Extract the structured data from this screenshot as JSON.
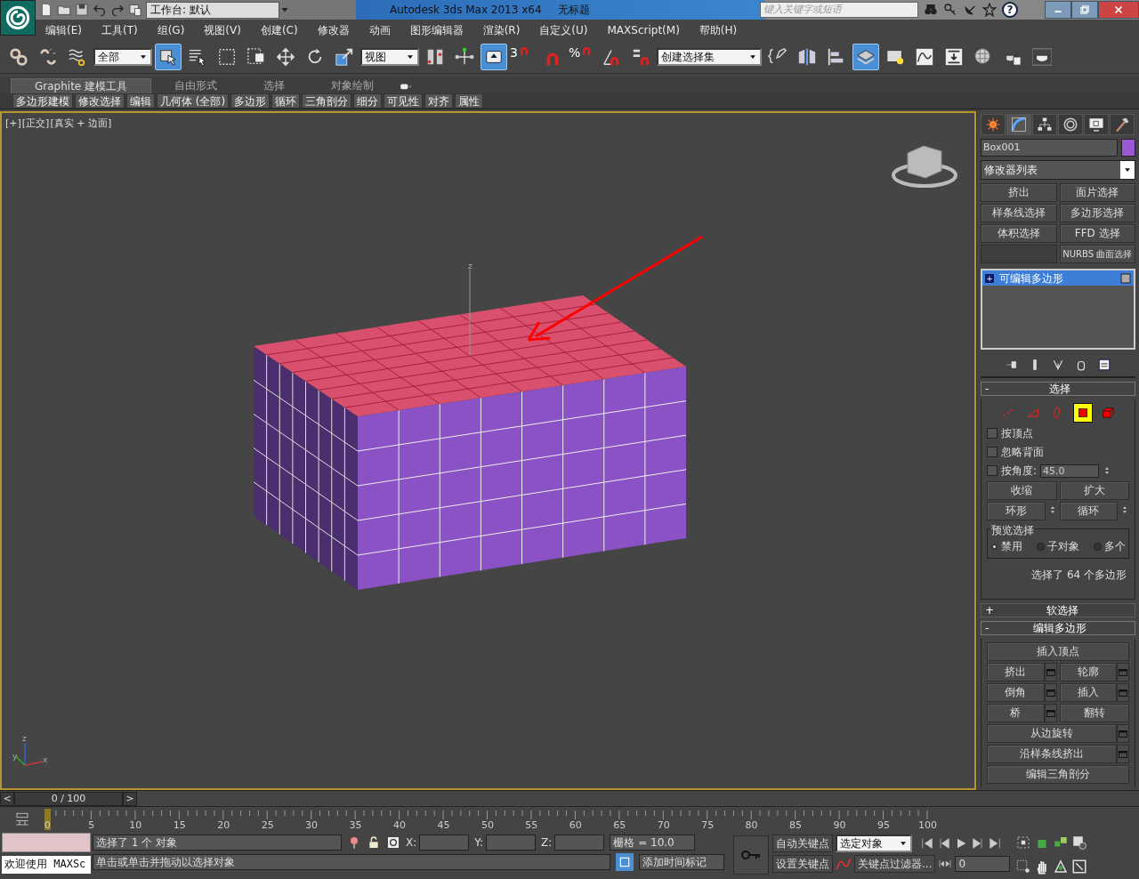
{
  "title_bar": {
    "workspace": "工作台: 默认",
    "title": "Autodesk 3ds Max  2013 x64",
    "document": "无标题",
    "search_placeholder": "键入关键字或短语",
    "help": "?"
  },
  "menu": [
    "编辑(E)",
    "工具(T)",
    "组(G)",
    "视图(V)",
    "创建(C)",
    "修改器",
    "动画",
    "图形编辑器",
    "渲染(R)",
    "自定义(U)",
    "MAXScript(M)",
    "帮助(H)"
  ],
  "toolbar": [
    {
      "kind": "tool",
      "selected": false
    },
    {
      "kind": "tool",
      "selected": false
    },
    {
      "kind": "tool",
      "selected": false
    },
    {
      "kind": "dropdown",
      "value": "全部"
    },
    {
      "kind": "tool",
      "selected": true
    },
    {
      "kind": "tool",
      "selected": false
    },
    {
      "kind": "tool",
      "selected": false
    },
    {
      "kind": "tool",
      "selected": false
    },
    {
      "kind": "tool",
      "selected": false
    },
    {
      "kind": "tool",
      "selected": false
    },
    {
      "kind": "tool",
      "selected": false
    },
    {
      "kind": "dropdown",
      "value": "视图"
    },
    {
      "kind": "tool",
      "selected": false
    },
    {
      "kind": "tool",
      "selected": false
    },
    {
      "kind": "tool",
      "selected": true
    },
    {
      "kind": "snap",
      "label": "3"
    },
    {
      "kind": "tool",
      "selected": false
    },
    {
      "kind": "snap",
      "label": "%"
    },
    {
      "kind": "tool",
      "selected": false
    },
    {
      "kind": "tool",
      "selected": false
    },
    {
      "kind": "dropdown",
      "value": "创建选择集"
    },
    {
      "kind": "tool",
      "selected": false
    },
    {
      "kind": "tool",
      "selected": false
    },
    {
      "kind": "tool",
      "selected": false
    },
    {
      "kind": "tool",
      "selected": true
    },
    {
      "kind": "tool",
      "selected": false
    },
    {
      "kind": "tool",
      "selected": false
    },
    {
      "kind": "tool",
      "selected": false
    },
    {
      "kind": "tool",
      "selected": false
    },
    {
      "kind": "tool",
      "selected": false
    },
    {
      "kind": "tool",
      "selected": false
    }
  ],
  "ribbon": {
    "tabs": [
      {
        "label": "Graphite 建模工具",
        "selected": true
      },
      {
        "label": "自由形式",
        "selected": false
      },
      {
        "label": "选择",
        "selected": false
      },
      {
        "label": "对象绘制",
        "selected": false
      }
    ],
    "panels": [
      "多边形建模",
      "修改选择",
      "编辑",
      "几何体 (全部)",
      "多边形",
      "循环",
      "三角剖分",
      "细分",
      "可见性",
      "对齐",
      "属性"
    ]
  },
  "viewport": {
    "labels": [
      "[+]",
      "[正交]",
      "[真实 + 边面]"
    ],
    "gizmo_axis": "z",
    "tripod": [
      "z",
      "y",
      "x"
    ]
  },
  "command_panel": {
    "tabs": [
      {
        "selected": false
      },
      {
        "selected": true
      },
      {
        "selected": false
      },
      {
        "selected": false
      },
      {
        "selected": false
      },
      {
        "selected": false
      }
    ],
    "object": {
      "name": "Box001",
      "color": "#9b59d6"
    },
    "modifier_list": "修改器列表",
    "modifier_buttons": [
      {
        "label": "挤出"
      },
      {
        "label": "面片选择"
      },
      {
        "label": "样条线选择"
      },
      {
        "label": "多边形选择"
      },
      {
        "label": "体积选择"
      },
      {
        "label": "FFD 选择"
      },
      {
        "kind": "blank"
      },
      {
        "label": "NURBS 曲面选择"
      }
    ],
    "stack": [
      {
        "label": "可编辑多边形",
        "selected": true,
        "expand": "+"
      }
    ],
    "selection_rollout": {
      "title": "选择",
      "toggle": "-",
      "expanded": true,
      "subobjects": [
        {
          "selected": false
        },
        {
          "selected": false
        },
        {
          "selected": false
        },
        {
          "selected": true
        },
        {
          "selected": false
        }
      ],
      "checkboxes": [
        {
          "label": "按顶点",
          "checked": false
        },
        {
          "label": "忽略背面",
          "checked": false
        },
        {
          "label": "按角度:",
          "checked": false
        }
      ],
      "angle": "45.0",
      "buttons": [
        "收缩",
        "扩大",
        "环形",
        "循环"
      ],
      "preview": {
        "title": "预览选择",
        "options": [
          {
            "label": "禁用",
            "selected": true
          },
          {
            "label": "子对象",
            "selected": false
          },
          {
            "label": "多个",
            "selected": false
          }
        ]
      },
      "status": "选择了 64 个多边形"
    },
    "soft_selection": {
      "title": "软选择",
      "toggle": "+",
      "expanded": false
    },
    "edit_poly": {
      "title": "编辑多边形",
      "toggle": "-",
      "expanded": true,
      "buttons": [
        {
          "label": "插入顶点",
          "wide": true,
          "settings": false
        },
        {
          "label": "挤出",
          "wide": false,
          "settings": true
        },
        {
          "label": "轮廓",
          "wide": false,
          "settings": true
        },
        {
          "label": "倒角",
          "wide": false,
          "settings": true
        },
        {
          "label": "插入",
          "wide": false,
          "settings": true
        },
        {
          "label": "桥",
          "wide": false,
          "settings": true
        },
        {
          "label": "翻转",
          "wide": false,
          "settings": false
        },
        {
          "label": "从边旋转",
          "wide": true,
          "settings": true
        },
        {
          "label": "沿样条线挤出",
          "wide": true,
          "settings": true
        },
        {
          "label": "编辑三角剖分",
          "wide": true,
          "settings": false
        }
      ]
    }
  },
  "time_slider": {
    "label": "0 / 100",
    "prev": "<",
    "next": ">",
    "frames": [
      "0",
      "5",
      "10",
      "15",
      "20",
      "25",
      "30",
      "35",
      "40",
      "45",
      "50",
      "55",
      "60",
      "65",
      "70",
      "75",
      "80",
      "85",
      "90",
      "95",
      "100"
    ]
  },
  "status_bar": {
    "welcome": "欢迎使用 MAXSc",
    "selection": "选择了 1 个 对象",
    "x_label": "X:",
    "y_label": "Y:",
    "z_label": "Z:",
    "grid": "栅格 = 10.0",
    "prompt": "单击或单击并拖动以选择对象",
    "time_tag": "添加时间标记",
    "auto_key": "自动关键点",
    "set_key": "设置关键点",
    "key_set": "选定对象",
    "key_filters": "关键点过滤器...",
    "frame": "0"
  }
}
